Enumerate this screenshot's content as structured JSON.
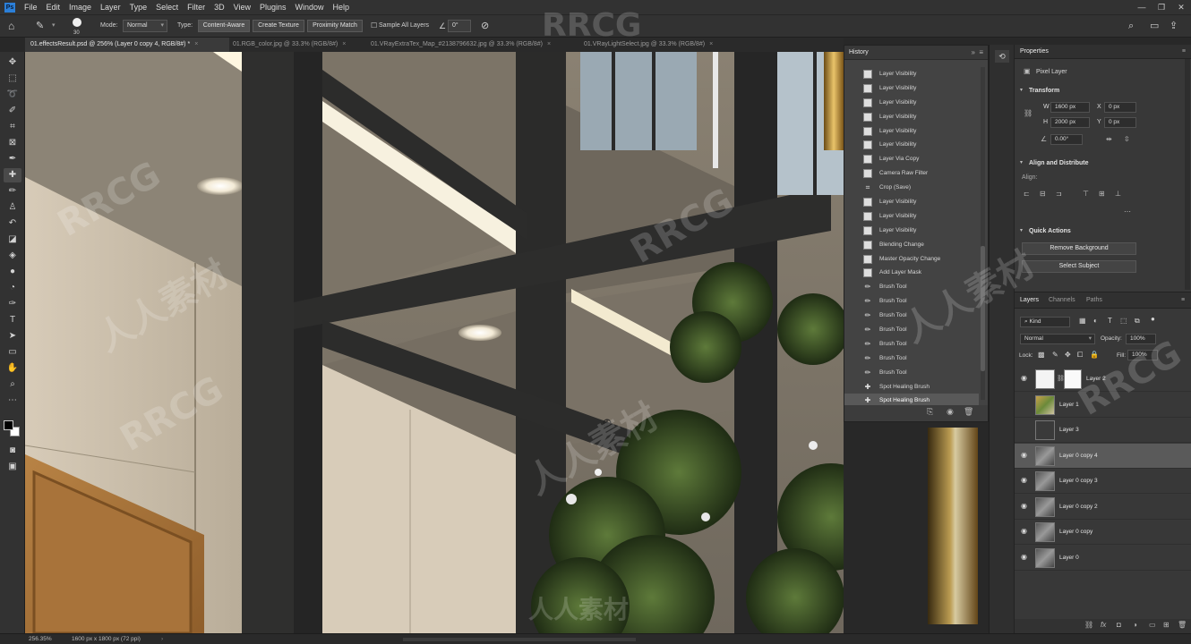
{
  "menu": {
    "app_logo": "Ps",
    "items": [
      "File",
      "Edit",
      "Image",
      "Layer",
      "Type",
      "Select",
      "Filter",
      "3D",
      "View",
      "Plugins",
      "Window",
      "Help"
    ],
    "window_controls": [
      "—",
      "❐",
      "✕"
    ]
  },
  "options": {
    "brush_size": "30",
    "mode_label": "Mode:",
    "mode_value": "Normal",
    "type_label": "Type:",
    "type_buttons": [
      "Content-Aware",
      "Create Texture",
      "Proximity Match"
    ],
    "sample_all_layers": "Sample All Layers",
    "angle_value": "0°"
  },
  "tabs": [
    "01.effectsResult.psd @ 256% (Layer 0 copy 4, RGB/8#) *",
    "01.RGB_color.jpg @ 33.3% (RGB/8#)",
    "01.VRayExtraTex_Map_#2138796632.jpg @ 33.3% (RGB/8#)",
    "01.VRayLightSelect.jpg @ 33.3% (RGB/8#)"
  ],
  "history": {
    "title": "History",
    "items": [
      {
        "label": "Layer Visibility",
        "icon": "doc"
      },
      {
        "label": "Layer Visibility",
        "icon": "doc"
      },
      {
        "label": "Layer Visibility",
        "icon": "doc"
      },
      {
        "label": "Layer Visibility",
        "icon": "doc"
      },
      {
        "label": "Layer Visibility",
        "icon": "doc"
      },
      {
        "label": "Layer Visibility",
        "icon": "doc"
      },
      {
        "label": "Layer Via Copy",
        "icon": "doc"
      },
      {
        "label": "Camera Raw Filter",
        "icon": "doc"
      },
      {
        "label": "Crop (Save)",
        "icon": "crop"
      },
      {
        "label": "Layer Visibility",
        "icon": "doc"
      },
      {
        "label": "Layer Visibility",
        "icon": "doc"
      },
      {
        "label": "Layer Visibility",
        "icon": "doc"
      },
      {
        "label": "Blending Change",
        "icon": "doc"
      },
      {
        "label": "Master Opacity Change",
        "icon": "doc"
      },
      {
        "label": "Add Layer Mask",
        "icon": "doc"
      },
      {
        "label": "Brush Tool",
        "icon": "brush"
      },
      {
        "label": "Brush Tool",
        "icon": "brush"
      },
      {
        "label": "Brush Tool",
        "icon": "brush"
      },
      {
        "label": "Brush Tool",
        "icon": "brush"
      },
      {
        "label": "Brush Tool",
        "icon": "brush"
      },
      {
        "label": "Brush Tool",
        "icon": "brush"
      },
      {
        "label": "Brush Tool",
        "icon": "brush"
      },
      {
        "label": "Spot Healing Brush",
        "icon": "heal"
      },
      {
        "label": "Spot Healing Brush",
        "icon": "heal",
        "active": true
      }
    ]
  },
  "properties": {
    "title": "Properties",
    "kind": "Pixel Layer",
    "transform_title": "Transform",
    "w_label": "W",
    "w_value": "1600 px",
    "h_label": "H",
    "h_value": "2000 px",
    "x_label": "X",
    "x_value": "0 px",
    "y_label": "Y",
    "y_value": "0 px",
    "angle_value": "0.00°",
    "align_title": "Align and Distribute",
    "align_label": "Align:",
    "quick_actions_title": "Quick Actions",
    "remove_background": "Remove Background",
    "select_subject": "Select Subject"
  },
  "layers": {
    "tabs": [
      "Layers",
      "Channels",
      "Paths"
    ],
    "kind_label": "Kind",
    "blend_mode": "Normal",
    "opacity_label": "Opacity:",
    "opacity_value": "100%",
    "lock_label": "Lock:",
    "fill_label": "Fill:",
    "fill_value": "100%",
    "items": [
      {
        "name": "Layer 2",
        "visible": true,
        "mask": true
      },
      {
        "name": "Layer 1",
        "visible": false
      },
      {
        "name": "Layer 3",
        "visible": false
      },
      {
        "name": "Layer 0 copy 4",
        "visible": true,
        "selected": true
      },
      {
        "name": "Layer 0 copy 3",
        "visible": true
      },
      {
        "name": "Layer 0 copy 2",
        "visible": true
      },
      {
        "name": "Layer 0 copy",
        "visible": true
      },
      {
        "name": "Layer 0",
        "visible": true
      }
    ]
  },
  "status": {
    "zoom": "256.35%",
    "doc_size": "1600 px x 1800 px (72 ppi)"
  },
  "watermark": {
    "text_latin": "RRCG",
    "text_cjk": "人人素材"
  }
}
